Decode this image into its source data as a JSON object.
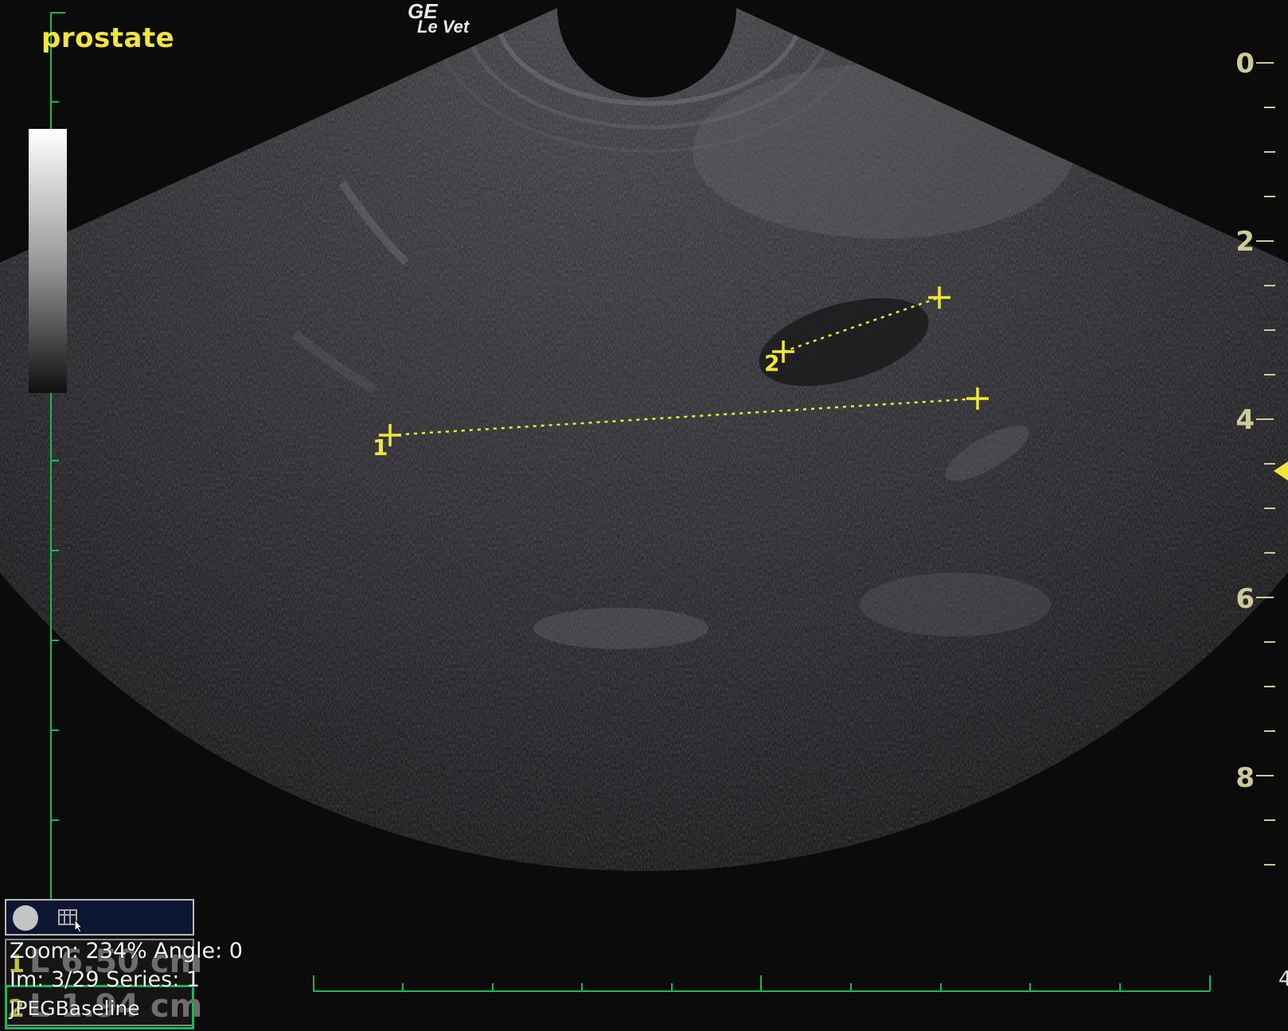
{
  "overlay": {
    "organ_label": "prostate",
    "brand_line1": "GE",
    "brand_line2": "Le Vet",
    "depth_scale": [
      "0",
      "2",
      "4",
      "6",
      "8"
    ],
    "corner_digit": "4"
  },
  "calipers": {
    "marker1_label": "1",
    "marker2_label": "2"
  },
  "measurements": {
    "row1_index": "1",
    "row1_value": "L 6.50 cm",
    "row2_index": "2",
    "row2_value": "L 1.94 cm"
  },
  "viewer_info": {
    "zoom_line": "Zoom: 234% Angle: 0",
    "image_line": "Im: 3/29   Series:  1",
    "codec_line": "JPEGBaseline"
  },
  "colors": {
    "annotation_yellow": "#f2e63a",
    "axis_green": "#1fb84e",
    "background": "#0b0b0b"
  },
  "icons": {
    "record": "record-icon",
    "film": "film-icon",
    "cursor": "cursor-icon"
  }
}
